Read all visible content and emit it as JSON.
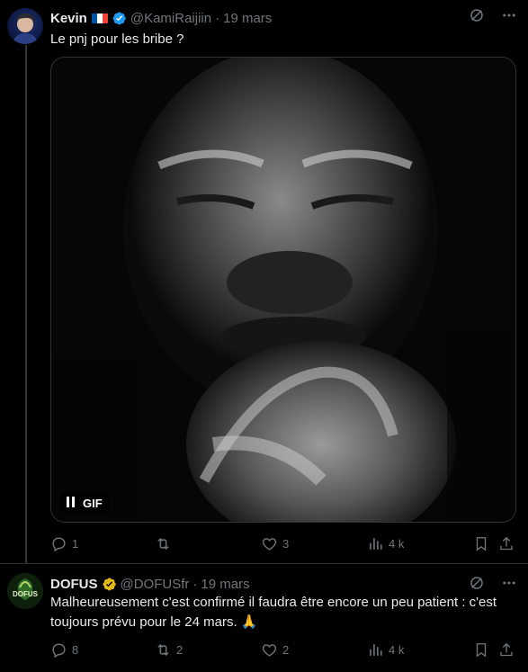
{
  "tweets": [
    {
      "author": {
        "name": "Kevin",
        "handle": "@KamiRaijiin",
        "verified": true,
        "flag": "france-flag"
      },
      "dot": "·",
      "date": "19 mars",
      "text": "Le pnj pour les bribe ?",
      "media": {
        "type": "gif",
        "badge": "GIF",
        "description_icon": "pause-icon"
      },
      "stats": {
        "replies": "1",
        "retweets": "",
        "likes": "3",
        "views": "4 k"
      }
    },
    {
      "author": {
        "name": "DOFUS",
        "handle": "@DOFUSfr",
        "verified": true,
        "verified_color": "#e2b719",
        "avatar_text": "DOFUS"
      },
      "dot": "·",
      "date": "19 mars",
      "text": "Malheureusement c'est confirmé il faudra être encore un peu patient : c'est toujours prévu pour le 24 mars. 🙏",
      "stats": {
        "replies": "8",
        "retweets": "2",
        "likes": "2",
        "views": "4 k"
      }
    }
  ],
  "colors": {
    "background": "#000000",
    "text": "#e7e9ea",
    "muted": "#71767b",
    "blue_check": "#1d9bf0",
    "gold_check": "#e2b719",
    "border": "#2f3336"
  }
}
